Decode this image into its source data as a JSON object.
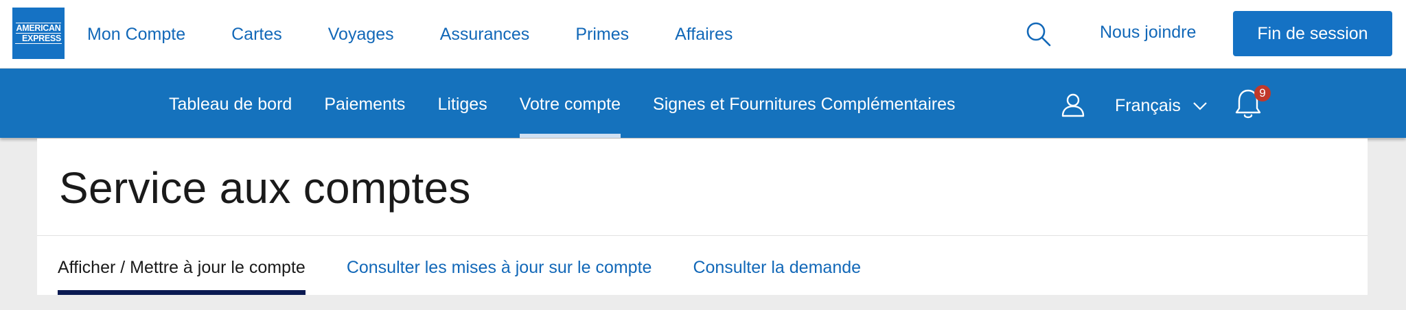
{
  "brand": {
    "logo_line1": "AMERICAN",
    "logo_line2": "EXPRESS",
    "color": "#1572c4"
  },
  "top_nav": {
    "items": [
      "Mon Compte",
      "Cartes",
      "Voyages",
      "Assurances",
      "Primes",
      "Affaires"
    ],
    "contact_label": "Nous joindre",
    "logout_label": "Fin de session"
  },
  "sub_nav": {
    "items": [
      "Tableau de bord",
      "Paiements",
      "Litiges",
      "Votre compte",
      "Signes et Fournitures Complémentaires"
    ],
    "active_index": 3,
    "language": "Français",
    "notification_count": "9"
  },
  "page": {
    "title": "Service aux comptes",
    "tabs": [
      "Afficher / Mettre à jour le compte",
      "Consulter les mises à jour sur le compte",
      "Consulter la demande"
    ],
    "active_tab_index": 0
  },
  "icons": [
    "search-icon",
    "user-icon",
    "chevron-down-icon",
    "bell-icon"
  ]
}
